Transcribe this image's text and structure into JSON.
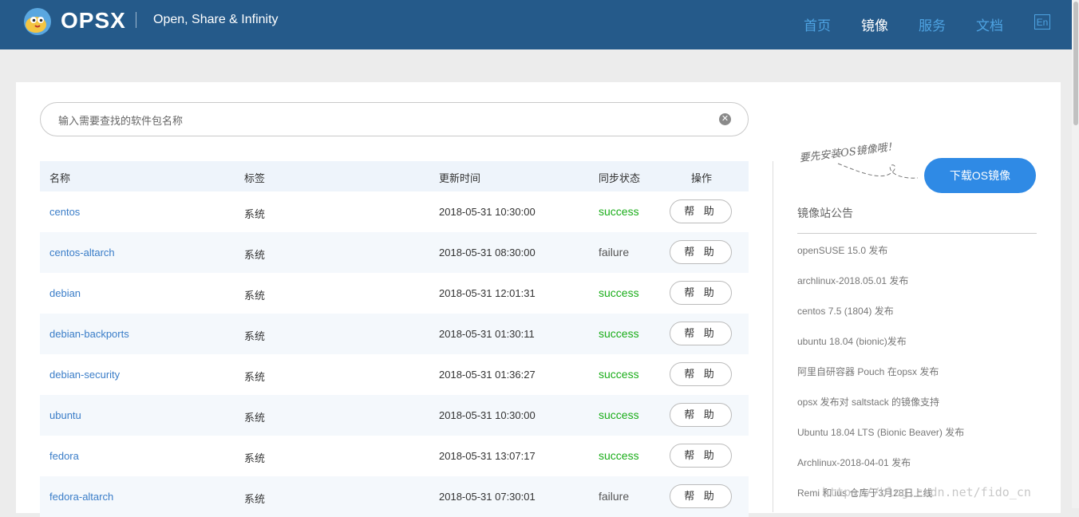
{
  "header": {
    "brand": "OPSX",
    "tagline": "Open, Share & Infinity",
    "nav": [
      {
        "label": "首页",
        "active": false
      },
      {
        "label": "镜像",
        "active": true
      },
      {
        "label": "服务",
        "active": false
      },
      {
        "label": "文档",
        "active": false
      }
    ],
    "lang_label": "En"
  },
  "search": {
    "placeholder": "输入需要查找的软件包名称",
    "value": ""
  },
  "table": {
    "headers": [
      "名称",
      "标签",
      "更新时间",
      "同步状态",
      "操作"
    ],
    "rows": [
      {
        "name": "centos",
        "tag": "系统",
        "time": "2018-05-31 10:30:00",
        "status": "success",
        "action": "帮 助"
      },
      {
        "name": "centos-altarch",
        "tag": "系统",
        "time": "2018-05-31 08:30:00",
        "status": "failure",
        "action": "帮 助"
      },
      {
        "name": "debian",
        "tag": "系统",
        "time": "2018-05-31 12:01:31",
        "status": "success",
        "action": "帮 助"
      },
      {
        "name": "debian-backports",
        "tag": "系统",
        "time": "2018-05-31 01:30:11",
        "status": "success",
        "action": "帮 助"
      },
      {
        "name": "debian-security",
        "tag": "系统",
        "time": "2018-05-31 01:36:27",
        "status": "success",
        "action": "帮 助"
      },
      {
        "name": "ubuntu",
        "tag": "系统",
        "time": "2018-05-31 10:30:00",
        "status": "success",
        "action": "帮 助"
      },
      {
        "name": "fedora",
        "tag": "系统",
        "time": "2018-05-31 13:07:17",
        "status": "success",
        "action": "帮 助"
      },
      {
        "name": "fedora-altarch",
        "tag": "系统",
        "time": "2018-05-31 07:30:01",
        "status": "failure",
        "action": "帮 助"
      }
    ]
  },
  "sidebar": {
    "hint": "要先安装OS镜像哦！",
    "download_label": "下载OS镜像",
    "notice_title": "镜像站公告",
    "notices": [
      "openSUSE 15.0 发布",
      "archlinux-2018.05.01 发布",
      "centos 7.5 (1804) 发布",
      "ubuntu 18.04 (bionic)发布",
      "阿里自研容器 Pouch 在opsx 发布",
      "opsx 发布对 saltstack 的镜像支持",
      "Ubuntu 18.04 LTS (Bionic Beaver) 发布",
      "Archlinux-2018-04-01 发布",
      "Remi 和 ius 仓库于3月28日上线"
    ]
  },
  "watermark": "https://blog.csdn.net/fido_cn",
  "colors": {
    "header_bg": "#255a8a",
    "accent": "#2f8ae5",
    "success": "#1aad19",
    "link": "#3a7dc8"
  }
}
